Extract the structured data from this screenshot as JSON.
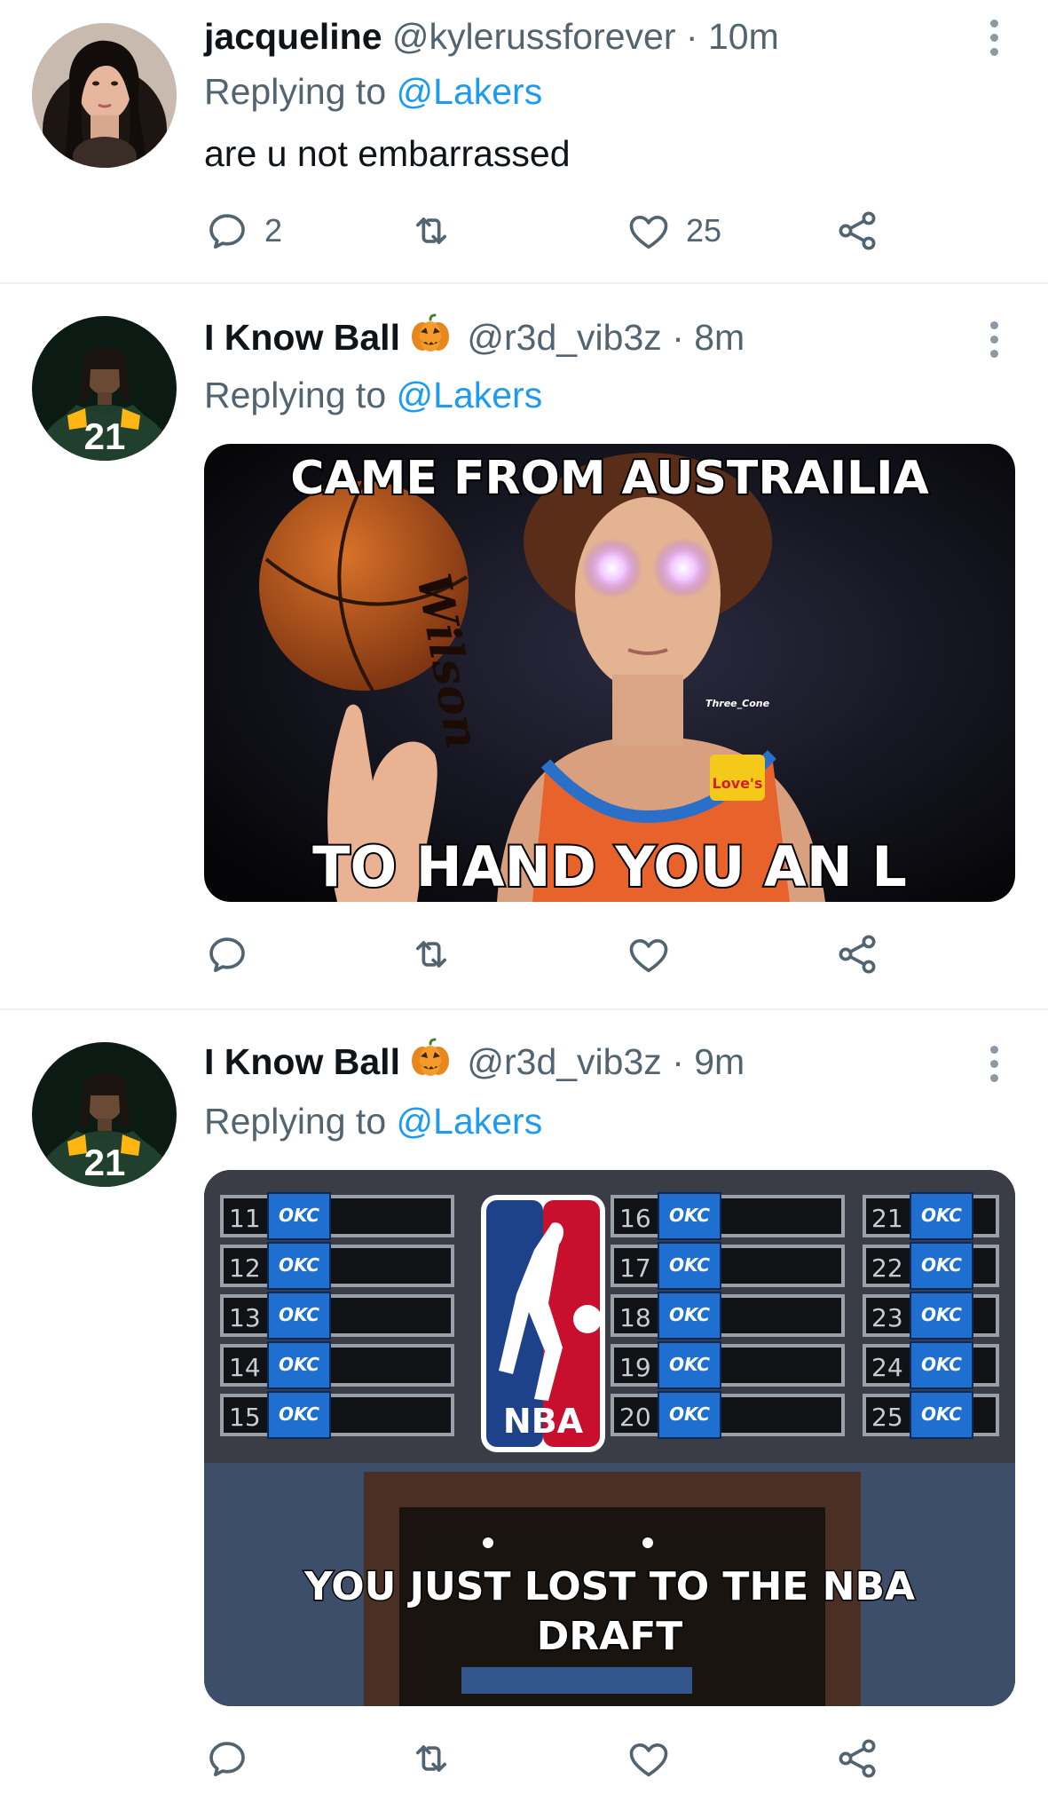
{
  "tweets": [
    {
      "display_name": "jacqueline",
      "handle": "@kylerussforever",
      "separator": "·",
      "time": "10m",
      "replying_prefix": "Replying to ",
      "replying_to": "@Lakers",
      "text": "are u not embarrassed",
      "reply_count": "2",
      "retweet_count": "",
      "like_count": "25"
    },
    {
      "display_name": "I Know Ball",
      "emoji": "jack-o-lantern",
      "handle": "@r3d_vib3z",
      "separator": "·",
      "time": "8m",
      "replying_prefix": "Replying to ",
      "replying_to": "@Lakers",
      "image": {
        "top_caption": "CAME FROM AUSTRAILIA",
        "bottom_caption": "TO HAND YOU AN L",
        "watermark": "Three_Cone",
        "jersey_logo": "Love's"
      }
    },
    {
      "display_name": "I Know Ball",
      "emoji": "jack-o-lantern",
      "handle": "@r3d_vib3z",
      "separator": "·",
      "time": "9m",
      "replying_prefix": "Replying to ",
      "replying_to": "@Lakers",
      "image": {
        "caption_line1": "YOU JUST LOST TO THE NBA",
        "caption_line2": "DRAFT",
        "logo_text": "NBA",
        "team_tag": "OKC",
        "picks": [
          "11",
          "12",
          "13",
          "14",
          "15",
          "16",
          "17",
          "18",
          "19",
          "20",
          "21",
          "22",
          "23",
          "24",
          "25"
        ]
      }
    }
  ],
  "colors": {
    "text_primary": "#0f1419",
    "text_secondary": "#536471",
    "link": "#1d9bf0",
    "divider": "#eff3f4"
  },
  "icons": [
    "reply-icon",
    "retweet-icon",
    "like-icon",
    "share-icon",
    "more-icon",
    "jack-o-lantern-icon"
  ]
}
